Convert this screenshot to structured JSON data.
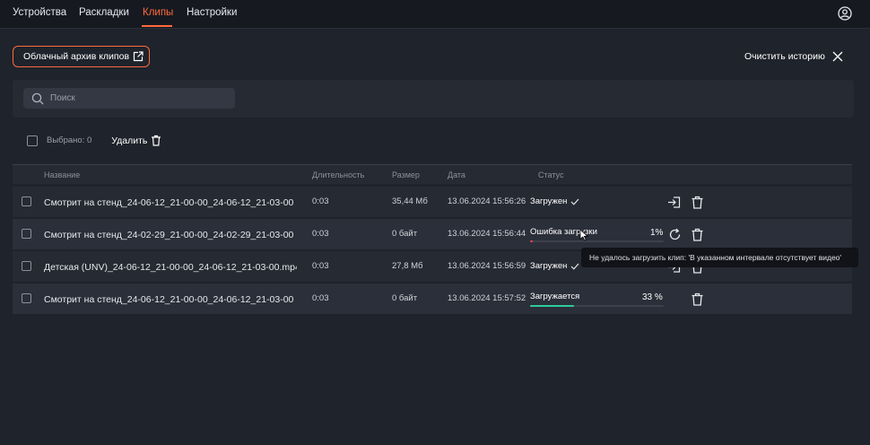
{
  "nav": {
    "tabs": [
      {
        "label": "Устройства",
        "active": false
      },
      {
        "label": "Раскладки",
        "active": false
      },
      {
        "label": "Клипы",
        "active": true
      },
      {
        "label": "Настройки",
        "active": false
      }
    ],
    "profile_icon": "user-circle-icon"
  },
  "toolbar": {
    "cloud_archive_label": "Облачный архив клипов",
    "cloud_archive_icon": "external-link-icon",
    "clear_history_label": "Очистить историю",
    "clear_history_icon": "close-icon"
  },
  "search": {
    "placeholder": "Поиск",
    "value": "",
    "icon": "search-icon"
  },
  "selection": {
    "selected_label": "Выбрано: 0",
    "delete_label": "Удалить",
    "delete_icon": "trash-icon"
  },
  "table": {
    "columns": [
      "Название",
      "Длительность",
      "Размер",
      "Дата",
      "Статус"
    ],
    "rows": [
      {
        "name": "Смотрит на стенд_24-06-12_21-00-00_24-06-12_21-03-00",
        "duration": "0:03",
        "size": "35,44 Мб",
        "date": "13.06.2024 15:56:26",
        "status": "Загружен",
        "status_icon": "check-icon",
        "actions": [
          "export-icon",
          "trash-icon"
        ]
      },
      {
        "name": "Смотрит на стенд_24-02-29_21-00-00_24-02-29_21-03-00",
        "duration": "0:03",
        "size": "0 байт",
        "date": "13.06.2024 15:56:44",
        "status": "Ошибка загрузки",
        "percent": "1%",
        "progress": 0.01,
        "progress_color": "#e5484d",
        "actions": [
          "retry-icon",
          "trash-icon"
        ]
      },
      {
        "name": "Детская (UNV)_24-06-12_21-00-00_24-06-12_21-03-00.mp4",
        "duration": "0:03",
        "size": "27,8 Мб",
        "date": "13.06.2024 15:56:59",
        "status": "Загружен",
        "status_icon": "check-icon",
        "actions": [
          "export-icon",
          "trash-icon"
        ]
      },
      {
        "name": "Смотрит на стенд_24-06-12_21-00-00_24-06-12_21-03-00",
        "duration": "0:03",
        "size": "0 байт",
        "date": "13.06.2024 15:57:52",
        "status": "Загружается",
        "percent": "33 %",
        "progress": 0.33,
        "progress_color": "#2ecc9a",
        "actions": [
          "trash-icon"
        ]
      }
    ]
  },
  "tooltip": {
    "text": "Не удалось загрузить клип: 'В указанном интервале отсутствует видео'"
  },
  "colors": {
    "accent": "#ff6a3d",
    "bg": "#1f232b",
    "success": "#2ecc9a",
    "error": "#e5484d"
  }
}
